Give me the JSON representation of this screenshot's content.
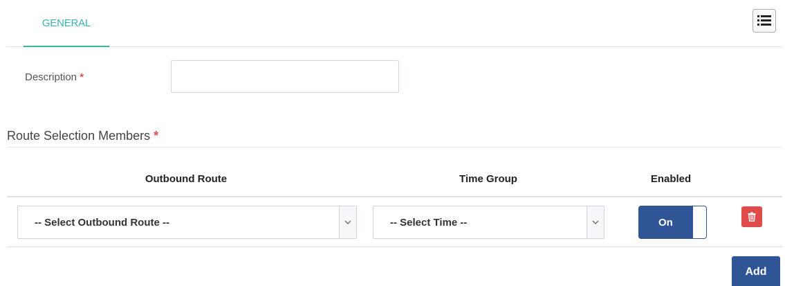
{
  "tabs": [
    {
      "label": "GENERAL",
      "active": true
    }
  ],
  "toolbar": {
    "menu_icon": "list-icon"
  },
  "form": {
    "description": {
      "label": "Description",
      "required_mark": "*",
      "value": "",
      "placeholder": ""
    }
  },
  "section": {
    "title": "Route Selection Members",
    "required_mark": "*"
  },
  "table": {
    "headers": [
      "Outbound Route",
      "Time Group",
      "Enabled"
    ],
    "rows": [
      {
        "outbound_route": "-- Select Outbound Route --",
        "time_group": "-- Select Time --",
        "enabled": "On",
        "delete_icon": "trash-icon"
      }
    ]
  },
  "actions": {
    "add_label": "Add"
  },
  "colors": {
    "accent": "#3bb3ad",
    "primary": "#2f5597",
    "danger": "#e04b4b",
    "required": "#d9534f"
  }
}
